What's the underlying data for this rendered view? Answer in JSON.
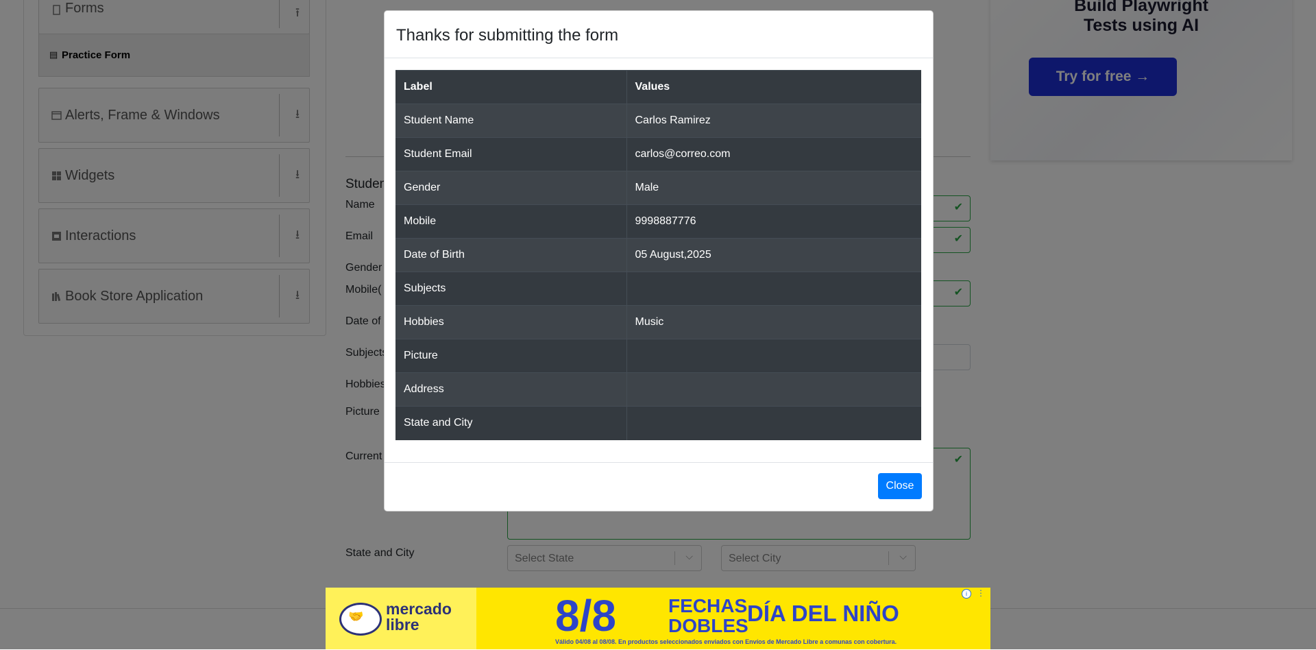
{
  "sidebar": {
    "groups": [
      {
        "label": "Forms",
        "icon": "document-icon",
        "action_icon": "collapse-icon"
      },
      {
        "label": "Alerts, Frame & Windows",
        "icon": "window-icon",
        "action_icon": "expand-icon"
      },
      {
        "label": "Widgets",
        "icon": "widgets-icon",
        "action_icon": "expand-icon"
      },
      {
        "label": "Interactions",
        "icon": "interactions-icon",
        "action_icon": "expand-icon"
      },
      {
        "label": "Book Store Application",
        "icon": "books-icon",
        "action_icon": "expand-icon"
      }
    ],
    "active_item": {
      "label": "Practice Form",
      "icon": "form-icon"
    }
  },
  "form": {
    "title_partial": "Studen",
    "labels": {
      "name": "Name",
      "email": "Email",
      "gender": "Gender",
      "mobile": "Mobile(",
      "dob": "Date of",
      "subjects": "Subjects",
      "hobbies": "Hobbies",
      "picture": "Picture",
      "current_address": "Current",
      "state_city": "State and City"
    },
    "state_select": {
      "placeholder": "Select State"
    },
    "city_select": {
      "placeholder": "Select City"
    }
  },
  "ad_right": {
    "headline_line1": "Build Playwright",
    "headline_line2": "Tests using AI",
    "button_label": "Try for free →"
  },
  "ad_bottom": {
    "brand_line1": "mercado",
    "brand_line2": "libre",
    "date": "8/8",
    "tagline_line1": "FECHAS",
    "tagline_line2": "DOBLES",
    "event": "DÍA DEL NIÑO",
    "fine_print": "Válido 04/08 al 08/08. En productos seleccionados enviados con Envíos de Mercado Libre a comunas con cobertura."
  },
  "modal": {
    "title": "Thanks for submitting the form",
    "table": {
      "headers": [
        "Label",
        "Values"
      ],
      "rows": [
        {
          "label": "Student Name",
          "value": "Carlos Ramirez"
        },
        {
          "label": "Student Email",
          "value": "carlos@correo.com"
        },
        {
          "label": "Gender",
          "value": "Male"
        },
        {
          "label": "Mobile",
          "value": "9998887776"
        },
        {
          "label": "Date of Birth",
          "value": "05 August,2025"
        },
        {
          "label": "Subjects",
          "value": ""
        },
        {
          "label": "Hobbies",
          "value": "Music"
        },
        {
          "label": "Picture",
          "value": ""
        },
        {
          "label": "Address",
          "value": ""
        },
        {
          "label": "State and City",
          "value": ""
        }
      ]
    },
    "close_label": "Close"
  },
  "colors": {
    "primary": "#007bff",
    "table_dark": "#343a40",
    "table_stripe": "#3e444a",
    "valid_green": "#28a745",
    "ad_yellow": "#ffe600",
    "ad_blue": "#2d44c8"
  }
}
